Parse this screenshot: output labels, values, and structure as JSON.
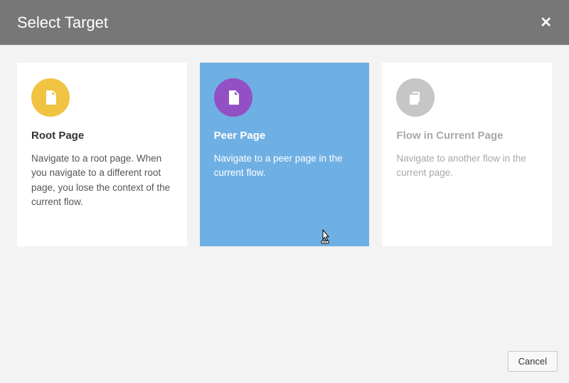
{
  "header": {
    "title": "Select Target"
  },
  "cards": [
    {
      "title": "Root Page",
      "desc": "Navigate to a root page. When you navigate to a different root page, you lose the context of the current flow."
    },
    {
      "title": "Peer Page",
      "desc": "Navigate to a peer page in the current flow."
    },
    {
      "title": "Flow in Current Page",
      "desc": "Navigate to another flow in the current page."
    }
  ],
  "footer": {
    "cancel": "Cancel"
  }
}
